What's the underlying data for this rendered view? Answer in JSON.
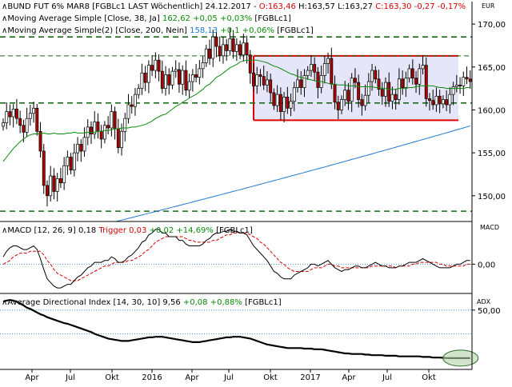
{
  "header": {
    "instrument": "BUND FUT 6% MAR8 [FGBLc1 LAST Wöchentlich] 24.12.2017",
    "open": "O:163,46",
    "high": "H:163,57",
    "low": "L:163,27",
    "close": "C:163,30",
    "change": "-0,27 -0,17%",
    "unit": "EUR"
  },
  "ma1": {
    "label": "Moving Average Simple [Close, 38, Ja]",
    "value": "162,62",
    "change": "+0,05 +0,03%",
    "ric": "[FGBLc1]",
    "color": "#0a8a0a"
  },
  "ma2": {
    "label": "Moving Average Simple(2) [Close, 200, Nein]",
    "value": "158,13",
    "change": "+0,1 +0,06%",
    "ric": "[FGBLc1]",
    "color": "#1e78d2"
  },
  "macd": {
    "label": "MACD [12, 26, 9]",
    "value": "0,18",
    "trigger_label": "Trigger",
    "trigger_value": "0,03",
    "change": "+0,02 +14,69%",
    "ric": "[FGBLc1]",
    "unit": "MACD",
    "tick": "0,00"
  },
  "adx": {
    "label": "Average Directional Index [14, 30, 10]",
    "value": "9,56",
    "change": "+0,08 +0,88%",
    "ric": "[FGBLc1]",
    "unit": "ADX",
    "tick": "50,00"
  },
  "chart_data": {
    "type": "candlestick",
    "price_axis": {
      "ticks": [
        "170,00",
        "165,00",
        "160,00",
        "155,00",
        "150,00"
      ],
      "tick_values": [
        170,
        165,
        160,
        155,
        150
      ],
      "range": [
        147,
        171.5
      ]
    },
    "time_axis": {
      "labels": [
        "Apr",
        "Jul",
        "Okt",
        "2016",
        "Apr",
        "Jul",
        "Okt",
        "2017",
        "Apr",
        "Jul",
        "Okt"
      ]
    },
    "horizontal_lines": [
      168.5,
      166.3,
      160.8,
      148.2
    ],
    "trading_range": {
      "top": 166.3,
      "bottom": 158.8,
      "fill": "#e6e6fa",
      "border": "#e00000"
    },
    "closes": [
      158.5,
      159.8,
      159.2,
      160.1,
      159.0,
      158.2,
      157.4,
      159.0,
      159.6,
      160.2,
      157.5,
      155.2,
      151.2,
      150.0,
      152.3,
      150.5,
      152.0,
      151.5,
      153.5,
      154.5,
      153.0,
      155.0,
      156.0,
      155.2,
      156.8,
      158.0,
      157.2,
      158.6,
      157.5,
      156.6,
      158.2,
      157.9,
      159.8,
      157.8,
      155.6,
      157.5,
      159.0,
      160.6,
      160.4,
      161.8,
      162.5,
      164.3,
      163.2,
      165.2,
      164.6,
      165.8,
      164.5,
      162.5,
      164.1,
      162.9,
      164.5,
      164.7,
      163.0,
      164.6,
      162.3,
      163.3,
      164.1,
      163.8,
      164.8,
      165.5,
      167.1,
      166.0,
      168.5,
      167.4,
      166.3,
      167.6,
      166.9,
      168.3,
      166.8,
      167.6,
      166.4,
      167.8,
      166.4,
      164.3,
      162.8,
      164.1,
      163.9,
      162.9,
      163.5,
      162.0,
      160.5,
      161.8,
      159.8,
      161.5,
      160.2,
      161.0,
      162.6,
      163.5,
      162.6,
      164.0,
      164.6,
      165.3,
      164.4,
      162.6,
      164.0,
      165.4,
      166.0,
      163.0,
      160.9,
      160.0,
      161.2,
      162.3,
      161.0,
      163.7,
      163.2,
      161.2,
      160.5,
      161.7,
      163.3,
      164.6,
      163.6,
      162.4,
      161.6,
      163.2,
      161.0,
      161.8,
      161.2,
      163.6,
      162.6,
      163.7,
      164.8,
      163.7,
      163.0,
      164.8,
      165.2,
      161.3,
      161.1,
      160.6,
      161.6,
      160.7,
      161.2,
      160.6,
      161.8,
      162.7,
      162.9,
      162.8,
      163.8,
      163.6,
      163.3
    ],
    "sma38": [
      154.0,
      154.5,
      155.0,
      155.5,
      155.9,
      156.3,
      156.6,
      156.9,
      157.1,
      157.2,
      157.2,
      157.2,
      157.3,
      157.2,
      157.2,
      157.3,
      157.2,
      157.2,
      157.2,
      157.3,
      157.3,
      157.4,
      157.3,
      157.3,
      157.3,
      157.4,
      157.4,
      157.4,
      157.5,
      157.5,
      157.6,
      157.6,
      157.7,
      157.8,
      157.8,
      157.9,
      157.9,
      157.9,
      158.0,
      158.0,
      158.1,
      158.2,
      158.3,
      158.5,
      158.7,
      159.0,
      159.2,
      159.4,
      159.5,
      159.8,
      160.1,
      160.4,
      160.6,
      160.9,
      161.1,
      161.4,
      161.6,
      161.8,
      162.1,
      162.4,
      162.8,
      163.0,
      163.4,
      163.8,
      164.0,
      164.3,
      164.6,
      164.9,
      165.1,
      165.3,
      165.6,
      165.7,
      165.8,
      165.8,
      165.8,
      165.8,
      165.7,
      165.6,
      165.5,
      165.3,
      165.1,
      165.0,
      164.8,
      164.6,
      164.4,
      164.2,
      164.1,
      163.9,
      163.8,
      163.7,
      163.6,
      163.5,
      163.4,
      163.3,
      163.3,
      163.2,
      163.1,
      163.0,
      163.0,
      162.9,
      162.9,
      162.9,
      162.8,
      162.8,
      162.8,
      162.7,
      162.7,
      162.7,
      162.7,
      162.7,
      162.6,
      162.6,
      162.5,
      162.5,
      162.4,
      162.4,
      162.4,
      162.5,
      162.5,
      162.5,
      162.6,
      162.6,
      162.7,
      162.8,
      162.8,
      162.8,
      162.8,
      162.8,
      162.7,
      162.6,
      162.6,
      162.5,
      162.5,
      162.5,
      162.5,
      162.5,
      162.5,
      162.6,
      162.6
    ],
    "sma200_start": {
      "value": 143.8,
      "week": 0
    },
    "sma200_end": {
      "value": 158.13,
      "week": 138
    },
    "macd_line": [
      0.4,
      0.7,
      0.9,
      1.0,
      1.0,
      0.9,
      0.8,
      0.8,
      0.9,
      1.0,
      0.8,
      0.3,
      -0.3,
      -0.8,
      -1.0,
      -1.2,
      -1.3,
      -1.3,
      -1.2,
      -1.1,
      -1.1,
      -0.9,
      -0.7,
      -0.6,
      -0.4,
      -0.2,
      -0.1,
      0.1,
      0.1,
      0.1,
      0.2,
      0.2,
      0.4,
      0.3,
      0.1,
      0.1,
      0.2,
      0.4,
      0.5,
      0.7,
      0.9,
      1.2,
      1.3,
      1.6,
      1.7,
      1.9,
      1.9,
      1.7,
      1.7,
      1.5,
      1.5,
      1.5,
      1.3,
      1.3,
      1.1,
      1.0,
      1.0,
      1.0,
      1.0,
      1.1,
      1.3,
      1.4,
      1.6,
      1.7,
      1.7,
      1.8,
      1.8,
      1.9,
      1.8,
      1.8,
      1.7,
      1.7,
      1.6,
      1.3,
      1.0,
      0.8,
      0.6,
      0.4,
      0.2,
      -0.1,
      -0.4,
      -0.5,
      -0.7,
      -0.8,
      -0.8,
      -0.8,
      -0.6,
      -0.5,
      -0.4,
      -0.3,
      -0.2,
      -0.0,
      -0.0,
      -0.1,
      -0.0,
      0.1,
      0.2,
      0.0,
      -0.2,
      -0.3,
      -0.4,
      -0.3,
      -0.3,
      -0.2,
      -0.1,
      -0.1,
      -0.2,
      -0.2,
      -0.1,
      0.0,
      0.1,
      0.0,
      -0.1,
      -0.1,
      -0.2,
      -0.2,
      -0.2,
      -0.1,
      -0.1,
      0.0,
      0.1,
      0.1,
      0.1,
      0.2,
      0.3,
      0.2,
      0.1,
      -0.0,
      -0.1,
      -0.2,
      -0.2,
      -0.2,
      -0.2,
      -0.1,
      -0.0,
      0.0,
      0.1,
      0.2,
      0.2
    ],
    "macd_trigger": [
      0.0,
      0.1,
      0.2,
      0.4,
      0.5,
      0.6,
      0.6,
      0.6,
      0.7,
      0.7,
      0.7,
      0.7,
      0.5,
      0.2,
      -0.0,
      -0.3,
      -0.5,
      -0.6,
      -0.7,
      -0.8,
      -0.9,
      -0.9,
      -0.9,
      -0.8,
      -0.7,
      -0.6,
      -0.5,
      -0.4,
      -0.3,
      -0.2,
      -0.1,
      -0.1,
      0.0,
      0.1,
      0.1,
      0.1,
      0.1,
      0.2,
      0.2,
      0.3,
      0.4,
      0.5,
      0.7,
      0.8,
      1.0,
      1.2,
      1.3,
      1.4,
      1.5,
      1.5,
      1.5,
      1.5,
      1.5,
      1.5,
      1.4,
      1.3,
      1.3,
      1.2,
      1.2,
      1.2,
      1.2,
      1.2,
      1.3,
      1.3,
      1.4,
      1.5,
      1.6,
      1.6,
      1.7,
      1.7,
      1.7,
      1.7,
      1.7,
      1.6,
      1.5,
      1.4,
      1.2,
      1.1,
      0.9,
      0.7,
      0.5,
      0.3,
      0.1,
      -0.0,
      -0.2,
      -0.3,
      -0.4,
      -0.4,
      -0.4,
      -0.4,
      -0.4,
      -0.3,
      -0.2,
      -0.2,
      -0.2,
      -0.1,
      -0.0,
      -0.0,
      -0.1,
      -0.1,
      -0.2,
      -0.2,
      -0.2,
      -0.2,
      -0.2,
      -0.2,
      -0.2,
      -0.2,
      -0.2,
      -0.1,
      -0.1,
      -0.1,
      -0.1,
      -0.1,
      -0.1,
      -0.1,
      -0.2,
      -0.1,
      -0.1,
      -0.1,
      -0.1,
      0.0,
      0.0,
      0.1,
      0.1,
      0.1,
      0.1,
      0.1,
      0.1,
      0.0,
      -0.0,
      -0.1,
      -0.1,
      -0.1,
      -0.1,
      -0.1,
      -0.1,
      -0.0,
      0.0
    ],
    "macd_level": 0.0,
    "adx": [
      57.0,
      58.0,
      58.5,
      58.0,
      57.0,
      55.5,
      54.0,
      52.0,
      51.0,
      49.5,
      48.0,
      46.5,
      45.5,
      44.0,
      43.0,
      42.0,
      41.0,
      40.0,
      39.0,
      38.5,
      37.5,
      36.5,
      35.5,
      34.5,
      33.5,
      32.5,
      31.5,
      30.0,
      29.0,
      28.0,
      27.0,
      26.0,
      25.5,
      25.0,
      24.5,
      24.0,
      24.0,
      24.0,
      24.5,
      25.0,
      25.5,
      26.0,
      26.5,
      27.0,
      27.0,
      27.5,
      27.5,
      27.5,
      27.0,
      26.5,
      26.0,
      25.5,
      25.0,
      24.5,
      24.0,
      23.5,
      23.0,
      23.0,
      23.0,
      23.5,
      24.0,
      24.5,
      25.0,
      25.5,
      26.0,
      26.5,
      27.0,
      27.0,
      27.5,
      27.5,
      27.5,
      27.0,
      26.5,
      26.0,
      25.0,
      24.0,
      23.0,
      22.0,
      21.0,
      20.5,
      20.0,
      19.5,
      19.0,
      18.5,
      18.0,
      18.0,
      18.0,
      18.0,
      18.0,
      17.5,
      17.5,
      17.5,
      17.0,
      17.0,
      17.0,
      16.5,
      16.0,
      15.5,
      15.0,
      14.5,
      14.0,
      13.5,
      13.5,
      13.0,
      13.0,
      13.0,
      13.0,
      12.5,
      12.5,
      12.0,
      12.0,
      12.0,
      12.0,
      11.5,
      11.5,
      11.5,
      11.5,
      11.0,
      11.0,
      11.0,
      11.0,
      11.0,
      11.0,
      11.0,
      10.5,
      10.5,
      10.5,
      10.0,
      10.0,
      10.0,
      9.8,
      9.6,
      9.5,
      9.5,
      9.5,
      9.5,
      9.5,
      9.5,
      9.5
    ],
    "adx_levels": [
      50,
      30
    ],
    "adx_range": [
      0,
      62
    ],
    "macd_range": [
      -1.6,
      2.2
    ]
  }
}
